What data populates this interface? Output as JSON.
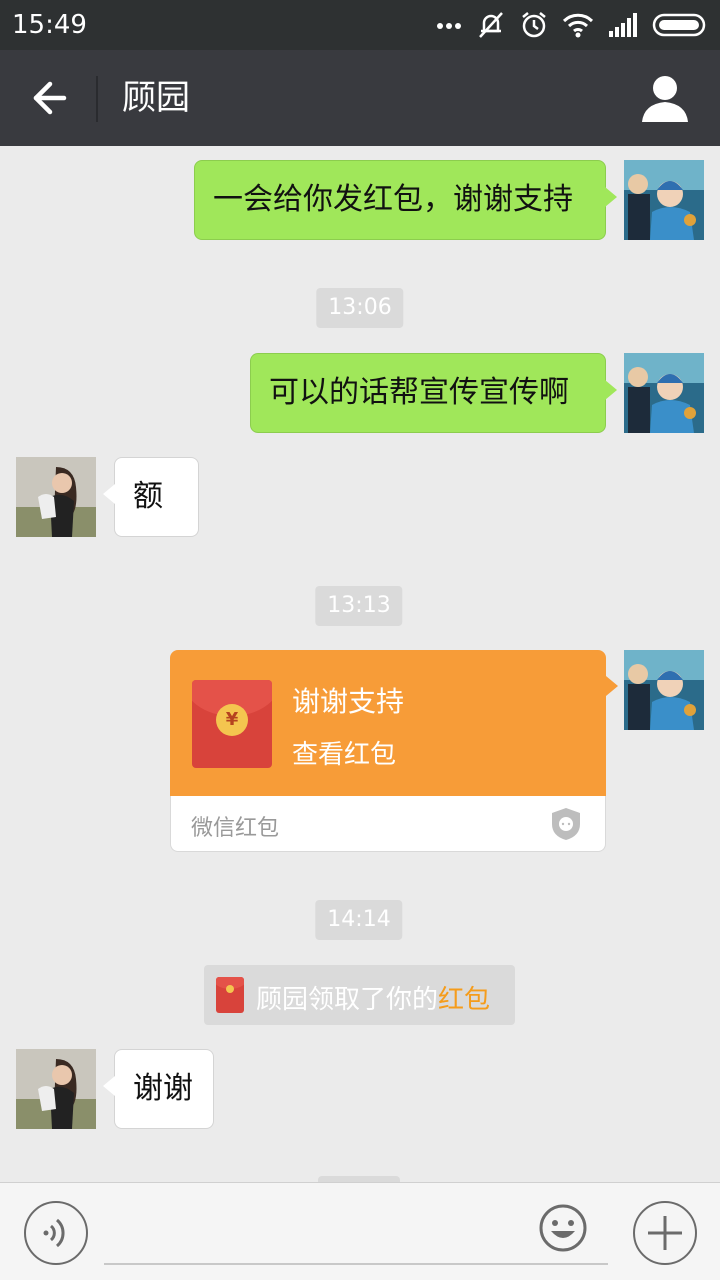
{
  "status_bar": {
    "time": "15:49",
    "icons": [
      "more-dots-icon",
      "mute-vibrate-icon",
      "alarm-icon",
      "wifi-icon",
      "signal-icon",
      "battery-icon"
    ]
  },
  "header": {
    "title": "顾园",
    "back_icon": "back-arrow-icon",
    "profile_icon": "person-icon",
    "background": "#393a3f"
  },
  "messages": [
    {
      "type": "outgoing",
      "text": "一会给你发红包，谢谢支持"
    },
    {
      "type": "timestamp",
      "text": "13:06"
    },
    {
      "type": "outgoing",
      "text": "可以的话帮宣传宣传啊"
    },
    {
      "type": "incoming",
      "text": "额"
    },
    {
      "type": "timestamp",
      "text": "13:13"
    },
    {
      "type": "red_packet",
      "title": "谢谢支持",
      "subtitle": "查看红包",
      "label": "微信红包"
    },
    {
      "type": "timestamp",
      "text": "14:14"
    },
    {
      "type": "system_notice",
      "text": "顾园领取了你的",
      "highlight": "红包"
    },
    {
      "type": "incoming",
      "text": "谢谢"
    }
  ],
  "colors": {
    "outgoing_bubble": "#a0e75a",
    "incoming_bubble": "#ffffff",
    "red_packet": "#f79c38",
    "chat_background": "#ebebeb",
    "highlight": "#f59c1b"
  },
  "input_bar": {
    "voice_icon": "voice-icon",
    "emoji_icon": "emoji-icon",
    "plus_icon": "plus-icon"
  }
}
